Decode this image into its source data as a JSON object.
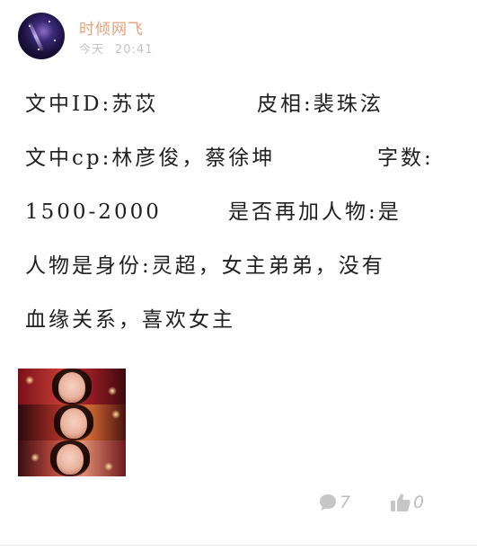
{
  "post": {
    "author": "时倾网飞",
    "time_day": "今天",
    "time_clock": "20:41",
    "lines": [
      {
        "a": "文中ID:苏苡",
        "b": "皮相:裴珠泫"
      },
      {
        "a": "文中cp:林彦俊，蔡徐坤",
        "b": "字数:"
      },
      {
        "a": "1500-2000",
        "b": "是否再加人物:是"
      },
      {
        "a": "人物是身份:灵超，女主弟弟，没有",
        "b": ""
      },
      {
        "a": "血缘关系，喜欢女主",
        "b": ""
      }
    ]
  },
  "images": [
    {
      "icon": "photo-thumbnail"
    },
    {
      "icon": "photo-thumbnail"
    },
    {
      "icon": "photo-thumbnail"
    }
  ],
  "actions": {
    "comment_icon": "comment-bubble-icon",
    "comment_count": "7",
    "like_icon": "thumbs-up-icon",
    "like_count": "0"
  },
  "colors": {
    "author": "#e8a07a",
    "timestamp": "#c4c4c4",
    "action": "#bdbdbd"
  }
}
